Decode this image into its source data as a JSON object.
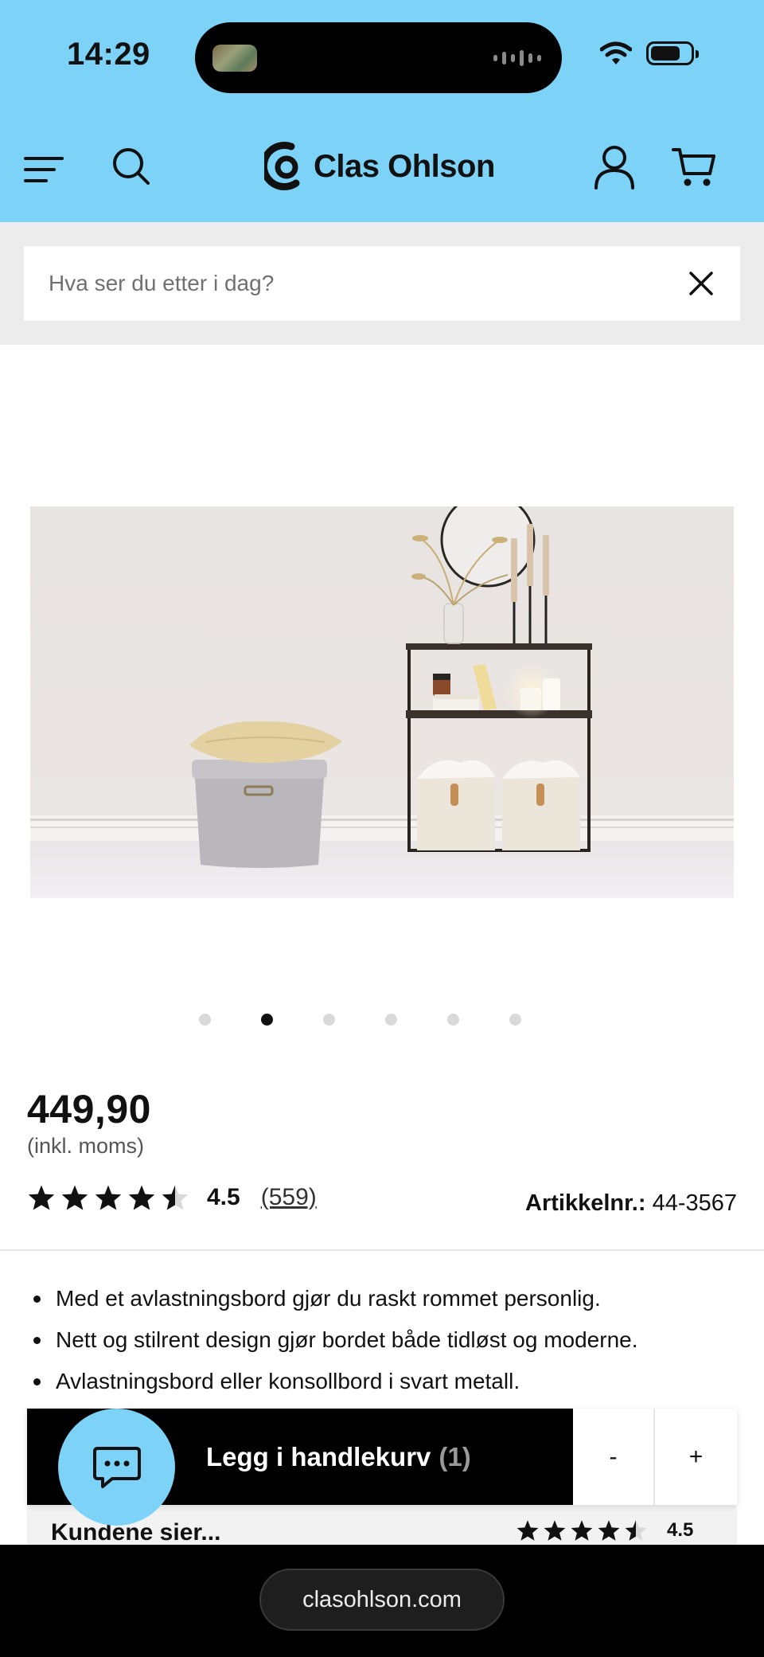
{
  "status_bar": {
    "time": "14:29"
  },
  "header": {
    "brand": "Clas Ohlson",
    "background": "#7dd3f7"
  },
  "search": {
    "placeholder": "Hva ser du etter i dag?",
    "value": ""
  },
  "gallery": {
    "total_images": 6,
    "active_index": 1
  },
  "product": {
    "price": "449,90",
    "price_note": "(inkl. moms)",
    "rating": 4.5,
    "rating_label": "4.5",
    "review_count": "(559)",
    "article_label": "Artikkelnr.:",
    "article_number": "44-3567",
    "bullets": [
      "Med et avlastningsbord gjør du raskt rommet personlig.",
      "Nett og stilrent design gjør bordet både tidløst og moderne.",
      "Avlastningsbord eller konsollbord i svart metall."
    ]
  },
  "cart_bar": {
    "add_label": "Legg i handlekurv",
    "count": "(1)",
    "minus": "-",
    "plus": "+"
  },
  "chat": {
    "icon": "chat-icon"
  },
  "reviews": {
    "title": "Kundene sier...",
    "rating_label": "4.5"
  },
  "browser": {
    "url": "clasohlson.com"
  }
}
